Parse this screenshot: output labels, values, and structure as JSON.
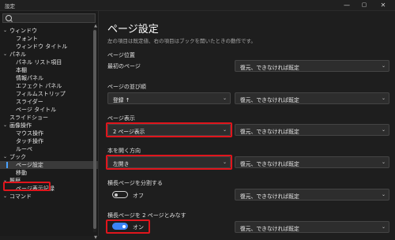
{
  "window": {
    "title": "設定",
    "minimize": "—",
    "maximize": "▢",
    "close": "✕"
  },
  "sidebar": {
    "search_placeholder": "",
    "items": [
      {
        "label": "ウィンドウ",
        "level": 0,
        "expanded": true
      },
      {
        "label": "フォント",
        "level": 1
      },
      {
        "label": "ウィンドウ タイトル",
        "level": 1
      },
      {
        "label": "パネル",
        "level": 0,
        "expanded": true
      },
      {
        "label": "パネル リスト項目",
        "level": 1
      },
      {
        "label": "本棚",
        "level": 1
      },
      {
        "label": "情報パネル",
        "level": 1
      },
      {
        "label": "エフェクト パネル",
        "level": 1
      },
      {
        "label": "フィルムストリップ",
        "level": 1
      },
      {
        "label": "スライダー",
        "level": 1
      },
      {
        "label": "ページ タイトル",
        "level": 1
      },
      {
        "label": "スライドショー",
        "level": 0
      },
      {
        "label": "画像操作",
        "level": 0,
        "expanded": true
      },
      {
        "label": "マウス操作",
        "level": 1
      },
      {
        "label": "タッチ操作",
        "level": 1
      },
      {
        "label": "ルーペ",
        "level": 1
      },
      {
        "label": "ブック",
        "level": 0,
        "expanded": true
      },
      {
        "label": "ページ設定",
        "level": 1,
        "selected": true
      },
      {
        "label": "移動",
        "level": 1
      },
      {
        "label": "履歴",
        "level": 0,
        "expanded": true
      },
      {
        "label": "ページ表示記録",
        "level": 1
      },
      {
        "label": "コマンド",
        "level": 0,
        "expanded": true
      }
    ]
  },
  "main": {
    "title": "ページ設定",
    "description": "左の項目は既定値、右の項目はブックを開いたときの動作です。",
    "sections": [
      {
        "label": "ページ位置",
        "left_value": "最初のページ",
        "right_value": "復元、できなければ既定"
      },
      {
        "label": "ページの並び順",
        "left_value": "登録 ↑",
        "right_value": "復元、できなければ既定"
      },
      {
        "label": "ページ表示",
        "left_value": "2 ページ表示",
        "right_value": "復元、できなければ既定"
      },
      {
        "label": "本を開く方向",
        "left_value": "左開き",
        "right_value": "復元、できなければ既定"
      },
      {
        "label": "横長ページを分割する",
        "toggle_label": "オフ",
        "toggle_on": false,
        "right_value": "復元、できなければ既定"
      },
      {
        "label": "横長ページを 2 ページとみなす",
        "toggle_label": "オン",
        "toggle_on": true,
        "right_value": "復元、できなければ既定"
      }
    ],
    "chevron": "⌄"
  },
  "colors": {
    "accent": "#3b84f5",
    "highlight": "#e0151c",
    "background": "#1e1e1e"
  }
}
